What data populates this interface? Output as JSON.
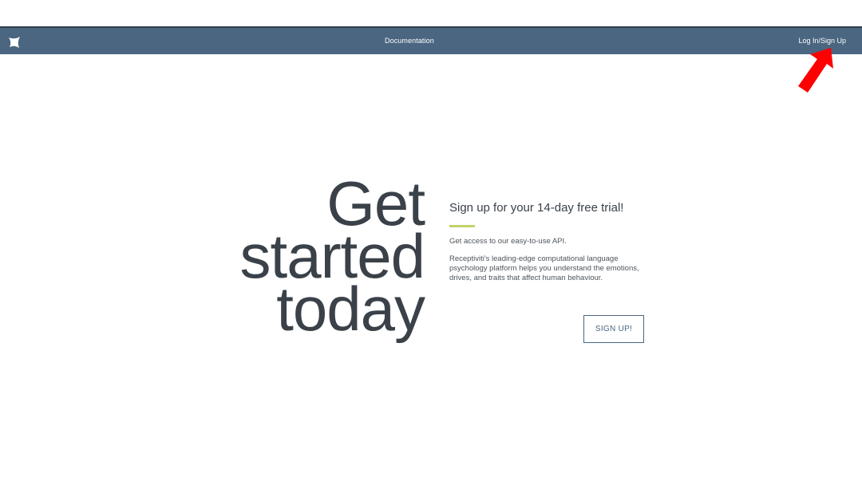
{
  "nav": {
    "documentation_label": "Documentation",
    "login_label": "Log In/Sign Up"
  },
  "hero": {
    "title_lines": [
      "Get",
      "started",
      "today"
    ]
  },
  "trial": {
    "heading": "Sign up for your 14-day free trial!",
    "access_text": "Get access to our easy-to-use API.",
    "description": "Receptiviti's leading-edge computational language psychology platform helps you understand the emotions, drives, and traits that affect human behaviour.",
    "button_label": "SIGN UP!"
  },
  "colors": {
    "navbar": "#4a6680",
    "accent": "#c3d26a",
    "arrow": "#ff0000",
    "text": "#3a4148"
  },
  "icons": {
    "logo": "receptiviti-logo-icon",
    "annotation": "red-arrow-icon"
  }
}
